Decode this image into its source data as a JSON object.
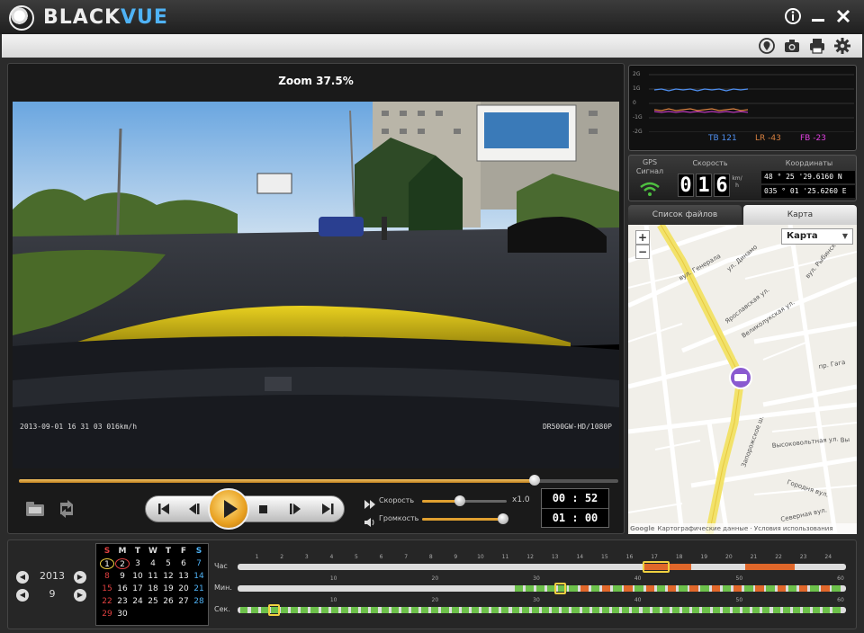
{
  "app": {
    "brand_part1": "BLACK",
    "brand_part2": "VUE",
    "window_buttons": [
      "info-icon",
      "minimize-icon",
      "close-icon"
    ]
  },
  "toolbar": {
    "icons": [
      "map-pin-icon",
      "camera-icon",
      "printer-icon",
      "gear-icon"
    ]
  },
  "player": {
    "zoom_label": "Zoom 37.5%",
    "osd_left": "2013-09-01 16 31 03  016km/h",
    "osd_right": "DR500GW-HD/1080P",
    "seek_progress": 0.86,
    "speed_label": "Скорость",
    "speed_value": "x1.0",
    "speed_level": 0.45,
    "volume_label": "Громкость",
    "volume_level": 0.96,
    "time_current": "00 : 52",
    "time_total": "01 : 00",
    "buttons": [
      "skip-start-icon",
      "step-back-icon",
      "play-icon",
      "stop-icon",
      "step-forward-icon",
      "skip-end-icon"
    ]
  },
  "gsensor": {
    "labels": [
      "2G",
      "1G",
      "0",
      "-1G",
      "-2G"
    ],
    "tb": "TB 121",
    "lr": "LR -43",
    "fb": "FB -23",
    "colors": {
      "tb": "#4f8ff0",
      "lr": "#d88040",
      "fb": "#e040e0"
    }
  },
  "gps": {
    "signal_label": "GPS\nСигнал",
    "signal_line1": "GPS",
    "signal_line2": "Сигнал",
    "speed_label": "Скорость",
    "speed_digits": [
      "0",
      "1",
      "6"
    ],
    "speed_unit": "km/h",
    "coords_label": "Координаты",
    "lat": "48 ° 25 '29.6160 N",
    "lon": "035 ° 01 '25.6260 E"
  },
  "tabs": {
    "files": "Список файлов",
    "map": "Карта"
  },
  "map": {
    "type_select": "Карта",
    "zoom_in": "+",
    "zoom_out": "−",
    "streets": [
      "вул. Генерала",
      "ул. Динамо",
      "вул. Рыбинск",
      "Ярославская ул.",
      "Великолукская ул.",
      "пр. Гага",
      "Запорожское ш.",
      "Высоковольтная ул.",
      "Вы",
      "Городня вул.",
      "Северная вул."
    ],
    "attribution_logo": "Google",
    "attribution": "Картографические данные · Условия использования"
  },
  "bottom": {
    "year": "2013",
    "month": "9",
    "calendar_headers": [
      "S",
      "M",
      "T",
      "W",
      "T",
      "F",
      "S"
    ],
    "calendar_rows": [
      [
        "",
        "1",
        "2",
        "3",
        "4",
        "5",
        "6",
        "7"
      ],
      [
        "",
        "8",
        "9",
        "10",
        "11",
        "12",
        "13",
        "14"
      ],
      [
        "",
        "15",
        "16",
        "17",
        "18",
        "19",
        "20",
        "21"
      ],
      [
        "",
        "22",
        "23",
        "24",
        "25",
        "26",
        "27",
        "28"
      ],
      [
        "",
        "29",
        "30",
        "",
        "",
        "",
        "",
        ""
      ]
    ],
    "hour_label": "Час",
    "min_label": "Мин.",
    "sec_label": "Сек.",
    "hour_ticks": [
      "1",
      "2",
      "3",
      "4",
      "5",
      "6",
      "7",
      "8",
      "9",
      "10",
      "11",
      "12",
      "13",
      "14",
      "15",
      "16",
      "17",
      "18",
      "19",
      "20",
      "21",
      "22",
      "23",
      "24"
    ],
    "min_ticks": [
      "10",
      "20",
      "30",
      "40",
      "50",
      "60"
    ],
    "sec_ticks": [
      "10",
      "20",
      "30",
      "40",
      "50",
      "60"
    ],
    "colors": {
      "recorded_normal": "#6cc04a",
      "recorded_event": "#e0672a",
      "marker": "#f0d040"
    }
  }
}
